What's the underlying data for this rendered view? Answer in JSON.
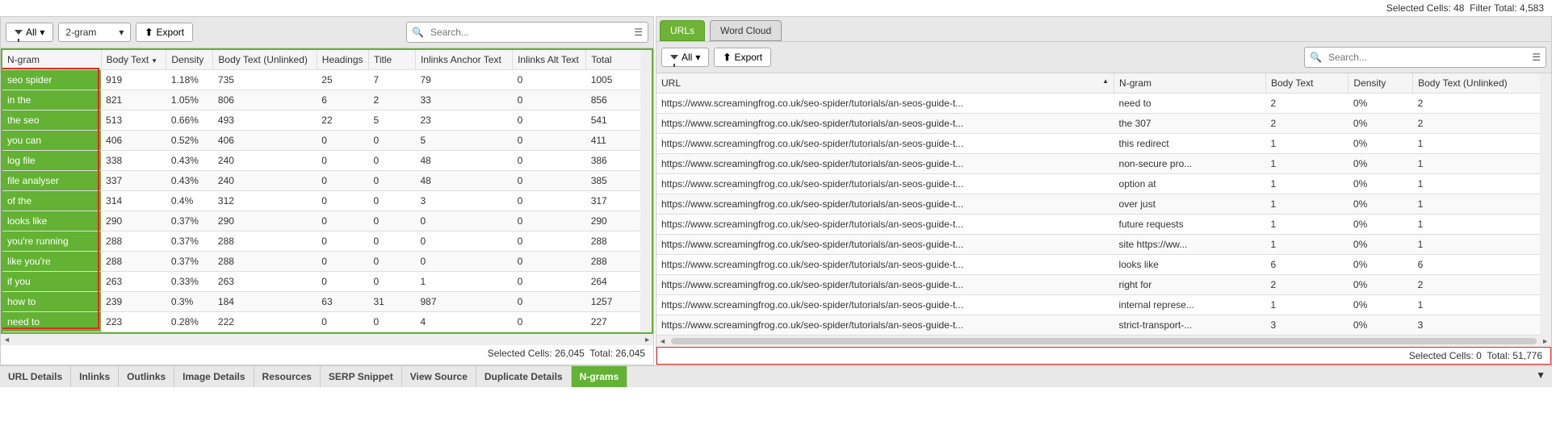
{
  "top_status": {
    "selected_label": "Selected Cells:",
    "selected_val": "48",
    "filter_label": "Filter Total:",
    "filter_val": "4,583"
  },
  "left": {
    "toolbar": {
      "all": "All",
      "gram": "2-gram",
      "export": "Export",
      "search_ph": "Search..."
    },
    "columns": [
      "N-gram",
      "Body Text",
      "Density",
      "Body Text (Unlinked)",
      "Headings",
      "Title",
      "Inlinks Anchor Text",
      "Inlinks Alt Text",
      "Total"
    ],
    "rows": [
      [
        "seo spider",
        "919",
        "1.18%",
        "735",
        "25",
        "7",
        "79",
        "0",
        "1005"
      ],
      [
        "in the",
        "821",
        "1.05%",
        "806",
        "6",
        "2",
        "33",
        "0",
        "856"
      ],
      [
        "the seo",
        "513",
        "0.66%",
        "493",
        "22",
        "5",
        "23",
        "0",
        "541"
      ],
      [
        "you can",
        "406",
        "0.52%",
        "406",
        "0",
        "0",
        "5",
        "0",
        "411"
      ],
      [
        "log file",
        "338",
        "0.43%",
        "240",
        "0",
        "0",
        "48",
        "0",
        "386"
      ],
      [
        "file analyser",
        "337",
        "0.43%",
        "240",
        "0",
        "0",
        "48",
        "0",
        "385"
      ],
      [
        "of the",
        "314",
        "0.4%",
        "312",
        "0",
        "0",
        "3",
        "0",
        "317"
      ],
      [
        "looks like",
        "290",
        "0.37%",
        "290",
        "0",
        "0",
        "0",
        "0",
        "290"
      ],
      [
        "you're running",
        "288",
        "0.37%",
        "288",
        "0",
        "0",
        "0",
        "0",
        "288"
      ],
      [
        "like you're",
        "288",
        "0.37%",
        "288",
        "0",
        "0",
        "0",
        "0",
        "288"
      ],
      [
        "if you",
        "263",
        "0.33%",
        "263",
        "0",
        "0",
        "1",
        "0",
        "264"
      ],
      [
        "how to",
        "239",
        "0.3%",
        "184",
        "63",
        "31",
        "987",
        "0",
        "1257"
      ],
      [
        "need to",
        "223",
        "0.28%",
        "222",
        "0",
        "0",
        "4",
        "0",
        "227"
      ]
    ],
    "footer": {
      "selected_label": "Selected Cells:",
      "selected_val": "26,045",
      "total_label": "Total:",
      "total_val": "26,045"
    }
  },
  "right": {
    "tabs": {
      "urls": "URLs",
      "wordcloud": "Word Cloud"
    },
    "toolbar": {
      "all": "All",
      "export": "Export",
      "search_ph": "Search..."
    },
    "columns": [
      "URL",
      "N-gram",
      "Body Text",
      "Density",
      "Body Text (Unlinked)"
    ],
    "rows": [
      [
        "https://www.screamingfrog.co.uk/seo-spider/tutorials/an-seos-guide-t...",
        "need to",
        "2",
        "0%",
        "2"
      ],
      [
        "https://www.screamingfrog.co.uk/seo-spider/tutorials/an-seos-guide-t...",
        "the 307",
        "2",
        "0%",
        "2"
      ],
      [
        "https://www.screamingfrog.co.uk/seo-spider/tutorials/an-seos-guide-t...",
        "this redirect",
        "1",
        "0%",
        "1"
      ],
      [
        "https://www.screamingfrog.co.uk/seo-spider/tutorials/an-seos-guide-t...",
        "non-secure pro...",
        "1",
        "0%",
        "1"
      ],
      [
        "https://www.screamingfrog.co.uk/seo-spider/tutorials/an-seos-guide-t...",
        "option at",
        "1",
        "0%",
        "1"
      ],
      [
        "https://www.screamingfrog.co.uk/seo-spider/tutorials/an-seos-guide-t...",
        "over just",
        "1",
        "0%",
        "1"
      ],
      [
        "https://www.screamingfrog.co.uk/seo-spider/tutorials/an-seos-guide-t...",
        "future requests",
        "1",
        "0%",
        "1"
      ],
      [
        "https://www.screamingfrog.co.uk/seo-spider/tutorials/an-seos-guide-t...",
        "site https://ww...",
        "1",
        "0%",
        "1"
      ],
      [
        "https://www.screamingfrog.co.uk/seo-spider/tutorials/an-seos-guide-t...",
        "looks like",
        "6",
        "0%",
        "6"
      ],
      [
        "https://www.screamingfrog.co.uk/seo-spider/tutorials/an-seos-guide-t...",
        "right for",
        "2",
        "0%",
        "2"
      ],
      [
        "https://www.screamingfrog.co.uk/seo-spider/tutorials/an-seos-guide-t...",
        "internal represe...",
        "1",
        "0%",
        "1"
      ],
      [
        "https://www.screamingfrog.co.uk/seo-spider/tutorials/an-seos-guide-t...",
        "strict-transport-...",
        "3",
        "0%",
        "3"
      ]
    ],
    "footer": {
      "selected_label": "Selected Cells:",
      "selected_val": "0",
      "total_label": "Total:",
      "total_val": "51,776"
    }
  },
  "bottom_tabs": [
    "URL Details",
    "Inlinks",
    "Outlinks",
    "Image Details",
    "Resources",
    "SERP Snippet",
    "View Source",
    "Duplicate Details",
    "N-grams"
  ]
}
